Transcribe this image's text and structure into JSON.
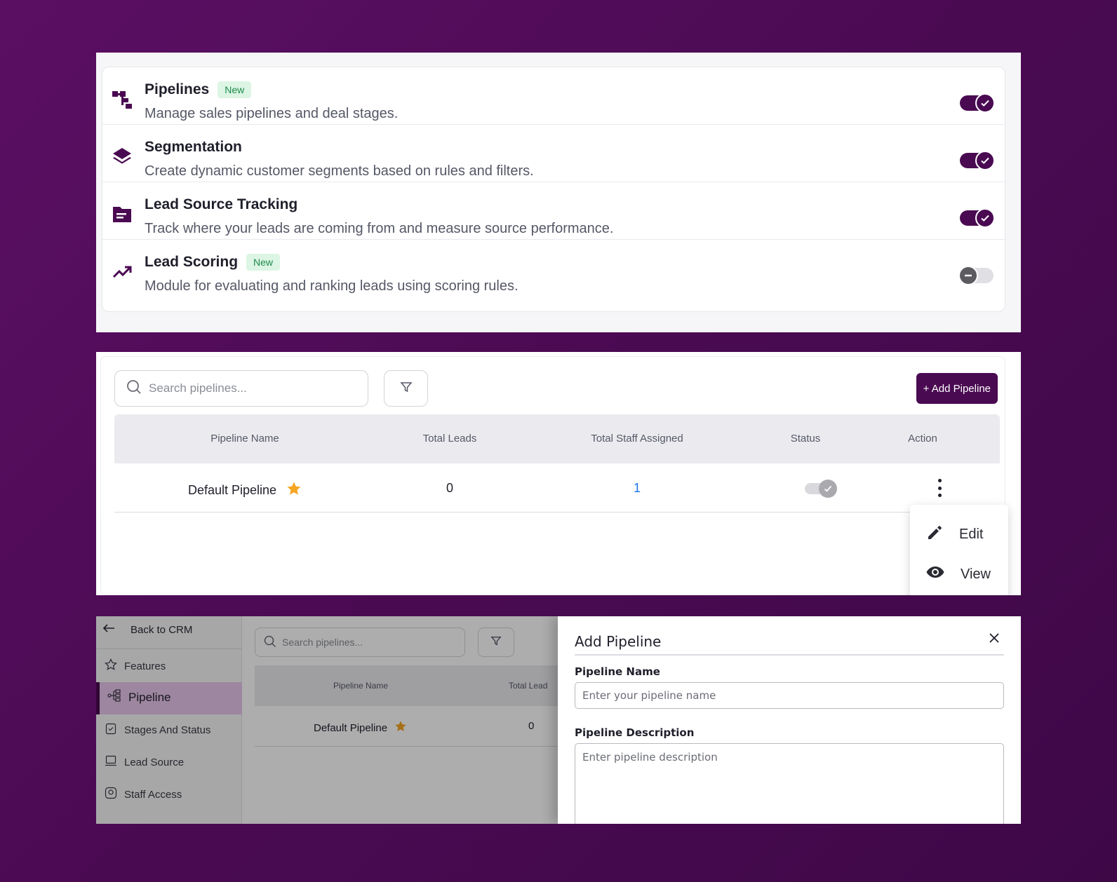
{
  "features": [
    {
      "title": "Pipelines",
      "badge": "New",
      "description": "Manage sales pipelines and deal stages.",
      "enabled": true,
      "icon": "pipeline-icon"
    },
    {
      "title": "Segmentation",
      "badge": "",
      "description": "Create dynamic customer segments based on rules and filters.",
      "enabled": true,
      "icon": "layers-icon"
    },
    {
      "title": "Lead Source Tracking",
      "badge": "",
      "description": "Track where your leads are coming from and measure source performance.",
      "enabled": true,
      "icon": "folder-icon"
    },
    {
      "title": "Lead Scoring",
      "badge": "New",
      "description": "Module for evaluating and ranking leads using scoring rules.",
      "enabled": false,
      "icon": "trending-up-icon"
    }
  ],
  "pipelines_list": {
    "search_placeholder": "Search pipelines...",
    "add_button": "+ Add Pipeline",
    "columns": [
      "Pipeline Name",
      "Total Leads",
      "Total Staff Assigned",
      "Status",
      "Action"
    ],
    "rows": [
      {
        "name": "Default Pipeline",
        "total_leads": "0",
        "total_staff": "1",
        "status": true,
        "default": true
      }
    ],
    "action_menu": [
      {
        "label": "Edit",
        "icon": "pencil-icon"
      },
      {
        "label": "View",
        "icon": "eye-icon"
      }
    ]
  },
  "sidebar": {
    "back_label": "Back to CRM",
    "items": [
      {
        "label": "Features",
        "icon": "star-outline-icon"
      },
      {
        "label": "Pipeline",
        "icon": "pipeline-tree-icon",
        "active": true
      },
      {
        "label": "Stages And Status",
        "icon": "clipboard-check-icon"
      },
      {
        "label": "Lead Source",
        "icon": "laptop-icon"
      },
      {
        "label": "Staff Access",
        "icon": "staff-key-icon"
      }
    ]
  },
  "background_list": {
    "search_placeholder": "Search pipelines...",
    "columns": [
      "Pipeline Name",
      "Total Lead"
    ],
    "row": {
      "name": "Default Pipeline",
      "total_leads": "0"
    }
  },
  "add_pipeline_drawer": {
    "title": "Add Pipeline",
    "name_label": "Pipeline Name",
    "name_placeholder": "Enter your pipeline name",
    "description_label": "Pipeline Description",
    "description_placeholder": "Enter pipeline description"
  },
  "colors": {
    "brand": "#4a0a52",
    "badge_bg": "#dcf5e4",
    "badge_text": "#1f8a4c",
    "link": "#1a73e8",
    "star": "#f5a623"
  }
}
